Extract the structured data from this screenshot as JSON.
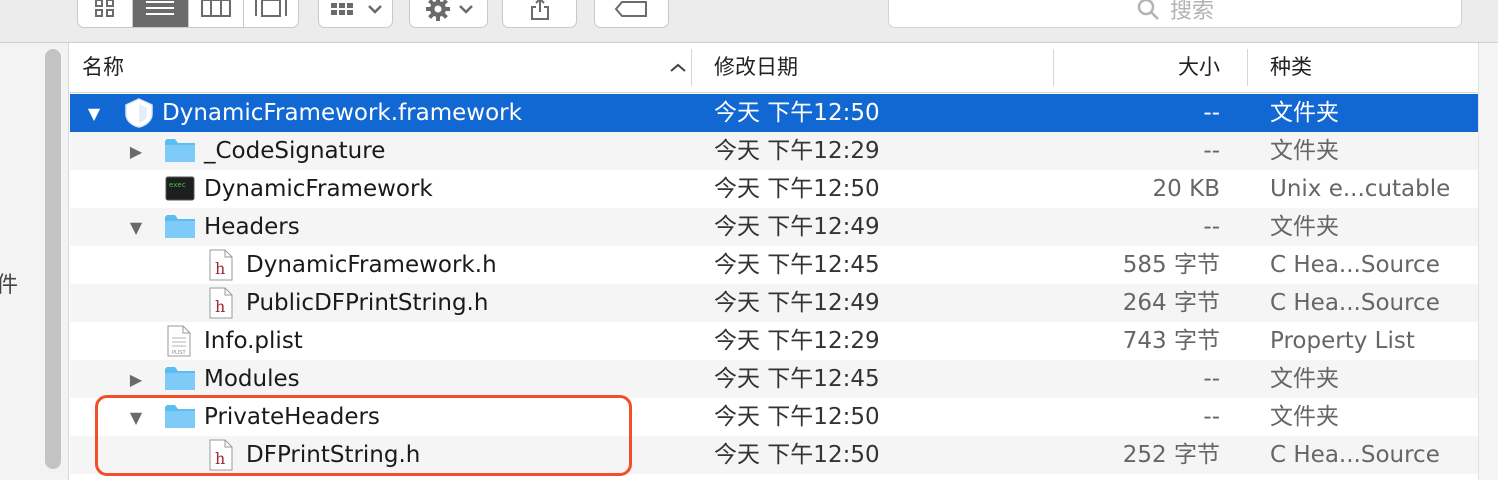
{
  "toolbar": {
    "view_buttons": [
      "icon-view",
      "list-view",
      "column-view",
      "gallery-view"
    ],
    "active_view": "list-view",
    "search_placeholder": "搜索"
  },
  "sidebar": {
    "partial_char": "件"
  },
  "columns": {
    "name": "名称",
    "date": "修改日期",
    "size": "大小",
    "kind": "种类"
  },
  "colors": {
    "selection": "#1268d3",
    "highlight_box": "#f24e2a",
    "folder": "#5bbdf4"
  },
  "rows": [
    {
      "name": "DynamicFramework.framework",
      "date": "今天 下午12:50",
      "size": "--",
      "kind": "文件夹",
      "icon": "framework-icon",
      "expanded": true,
      "selected": true
    },
    {
      "name": "_CodeSignature",
      "date": "今天 下午12:29",
      "size": "--",
      "kind": "文件夹",
      "icon": "folder-icon",
      "expanded": false
    },
    {
      "name": "DynamicFramework",
      "date": "今天 下午12:50",
      "size": "20 KB",
      "kind": "Unix e...cutable",
      "icon": "executable-icon"
    },
    {
      "name": "Headers",
      "date": "今天 下午12:49",
      "size": "--",
      "kind": "文件夹",
      "icon": "folder-icon",
      "expanded": true
    },
    {
      "name": "DynamicFramework.h",
      "date": "今天 下午12:45",
      "size": "585 字节",
      "kind": "C Hea...Source",
      "icon": "header-file-icon"
    },
    {
      "name": "PublicDFPrintString.h",
      "date": "今天 下午12:49",
      "size": "264 字节",
      "kind": "C Hea...Source",
      "icon": "header-file-icon"
    },
    {
      "name": "Info.plist",
      "date": "今天 下午12:29",
      "size": "743 字节",
      "kind": "Property List",
      "icon": "plist-file-icon"
    },
    {
      "name": "Modules",
      "date": "今天 下午12:45",
      "size": "--",
      "kind": "文件夹",
      "icon": "folder-icon",
      "expanded": false
    },
    {
      "name": "PrivateHeaders",
      "date": "今天 下午12:50",
      "size": "--",
      "kind": "文件夹",
      "icon": "folder-icon",
      "expanded": true
    },
    {
      "name": "DFPrintString.h",
      "date": "今天 下午12:50",
      "size": "252 字节",
      "kind": "C Hea...Source",
      "icon": "header-file-icon"
    }
  ]
}
